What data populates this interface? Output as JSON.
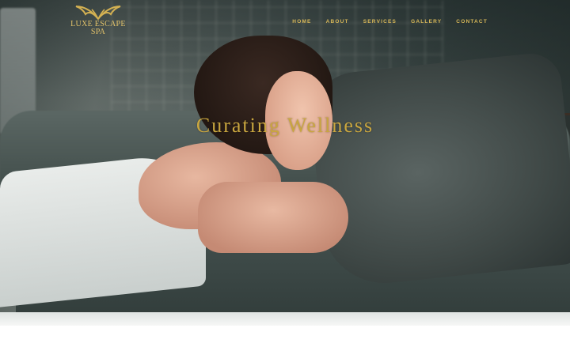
{
  "brand": {
    "name_line1": "LUXE ESCAPE",
    "name_line2": "SPA",
    "logo_icon": "wings-emblem-icon",
    "accent_color": "#d4b152"
  },
  "nav": {
    "items": [
      {
        "label": "HOME"
      },
      {
        "label": "ABOUT"
      },
      {
        "label": "SERVICES"
      },
      {
        "label": "GALLERY"
      },
      {
        "label": "CONTACT"
      }
    ]
  },
  "hero": {
    "headline": "Curating Wellness",
    "image_subject": "woman-relaxing-in-towel-on-sofa"
  }
}
